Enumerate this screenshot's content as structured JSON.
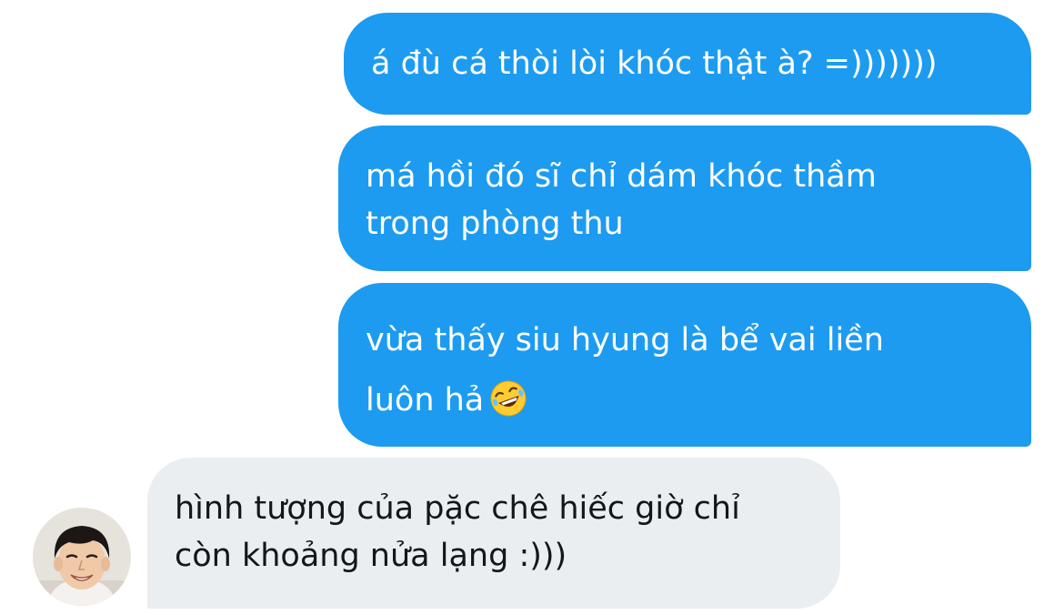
{
  "messages": [
    {
      "direction": "sent",
      "text": "á đù cá thòi lòi khóc thật à? =)))))))"
    },
    {
      "direction": "sent",
      "text": "má hồi đó sĩ chỉ dám khóc thầm\ntrong phòng thu"
    },
    {
      "direction": "sent",
      "text": "vừa thấy siu hyung là bể vai liền\nluôn hả",
      "emoji": "rolling-on-the-floor-laughing"
    },
    {
      "direction": "received",
      "text": "hình tượng của pặc chê hiếc giờ chỉ\ncòn khoảng nửa lạng :)))"
    }
  ],
  "colors": {
    "sent_bubble": "#1d9bf0",
    "sent_text": "#ffffff",
    "received_bubble": "#eaeef1",
    "received_text": "#141619"
  }
}
